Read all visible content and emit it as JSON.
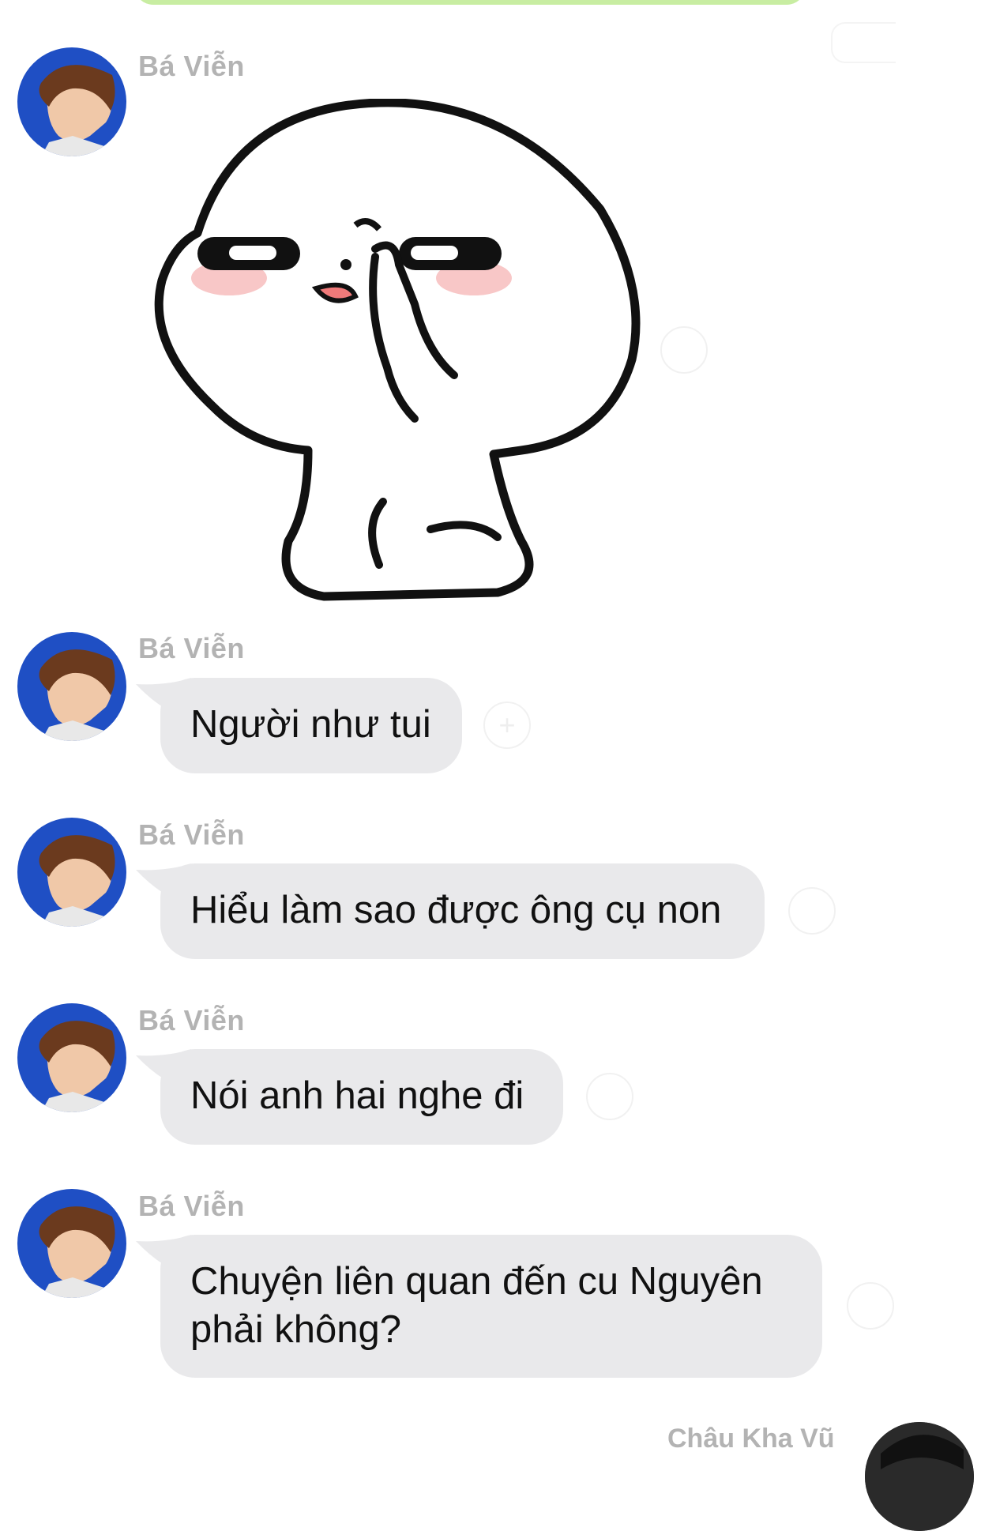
{
  "chat": {
    "messages": [
      {
        "sender": "Bá Viễn",
        "type": "sticker",
        "sticker_icon": "shush-character-sticker"
      },
      {
        "sender": "Bá Viễn",
        "type": "text",
        "text": "Người như tui"
      },
      {
        "sender": "Bá Viễn",
        "type": "text",
        "text": "Hiểu làm sao được ông cụ non"
      },
      {
        "sender": "Bá Viễn",
        "type": "text",
        "text": "Nói anh hai nghe đi"
      },
      {
        "sender": "Bá Viễn",
        "type": "text",
        "text": "Chuyện liên quan đến cu Nguyên phải không?"
      }
    ],
    "next_sender": "Châu Kha Vũ"
  },
  "colors": {
    "incoming_bubble": "#e9e9eb",
    "outgoing_bubble": "#c8eda2",
    "sender_name": "#b3b3b3",
    "avatar_background": "#1f4fc4"
  }
}
